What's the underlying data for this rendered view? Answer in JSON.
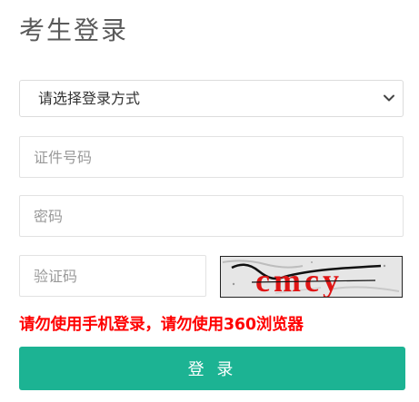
{
  "title": "考生登录",
  "login_method": {
    "selected": "请选择登录方式"
  },
  "fields": {
    "id_placeholder": "证件号码",
    "password_placeholder": "密码",
    "captcha_placeholder": "验证码"
  },
  "captcha_image": {
    "text": "cmcy",
    "text_color": "#e01515"
  },
  "warning": "请勿使用手机登录，请勿使用360浏览器",
  "login_button": "登 录",
  "colors": {
    "accent": "#1cb393",
    "warning": "#ff0000"
  },
  "icons": {
    "select_arrow": "chevron-down-icon"
  }
}
